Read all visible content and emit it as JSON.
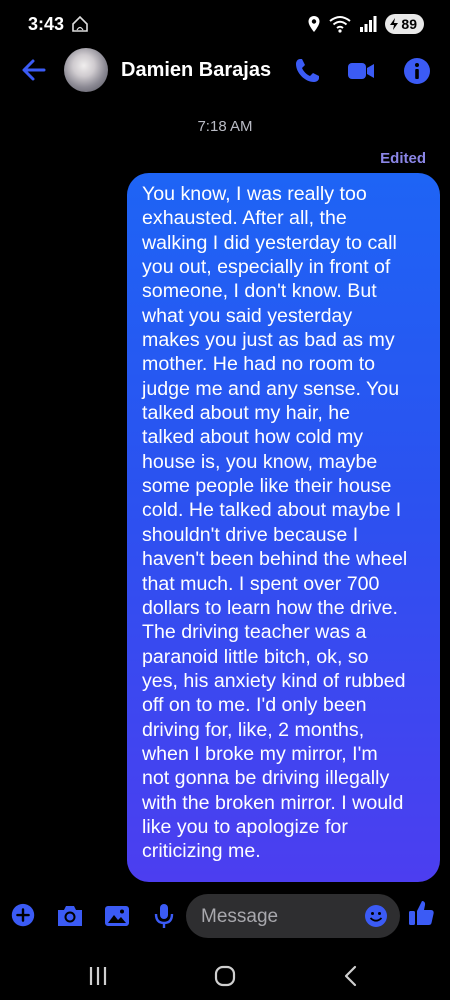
{
  "status_bar": {
    "time": "3:43",
    "battery": "89",
    "icons": [
      "home-alert-icon",
      "location-icon",
      "wifi-icon",
      "signal-icon",
      "battery-icon"
    ]
  },
  "header": {
    "contact_name": "Damien Barajas",
    "icons": [
      "back-arrow-icon",
      "phone-icon",
      "video-call-icon",
      "info-icon"
    ]
  },
  "conversation": {
    "timestamp": "7:18 AM",
    "edited_label": "Edited",
    "message_lines": [
      "You know, I was really too",
      "exhausted. After all, the",
      "walking I did yesterday to call",
      "you out, especially in front of",
      "someone, I don't know. But",
      "what you said yesterday",
      "makes you just as bad as my",
      "mother. He had no room to",
      "judge me and any sense. You",
      "talked about my hair, he",
      "talked about how cold my",
      "house is, you know, maybe",
      "some people like their house",
      "cold. He talked about maybe I",
      "shouldn't drive because I",
      "haven't been behind the wheel",
      "that much. I spent over 700",
      "dollars to learn how the drive.",
      "The driving teacher was a",
      "paranoid little bitch, ok, so",
      "yes, his anxiety kind of rubbed",
      "off on to me. I'd only been",
      "driving for, like, 2 months,",
      "when I broke my mirror, I'm",
      "not gonna be driving illegally",
      "with the broken mirror. I would",
      "like you to apologize for",
      "criticizing me."
    ]
  },
  "composer": {
    "placeholder": "Message",
    "icons": [
      "plus-icon",
      "camera-icon",
      "gallery-icon",
      "microphone-icon",
      "emoji-icon",
      "thumbs-up-icon"
    ]
  },
  "nav_bar": {
    "icons": [
      "recent-apps-icon",
      "home-icon",
      "back-icon"
    ]
  },
  "colors": {
    "accent": "#3b5bf5",
    "bubble_top": "#1e64f5",
    "bubble_bottom": "#4c3ef0",
    "edited": "#8b86e6",
    "background": "#000000"
  }
}
